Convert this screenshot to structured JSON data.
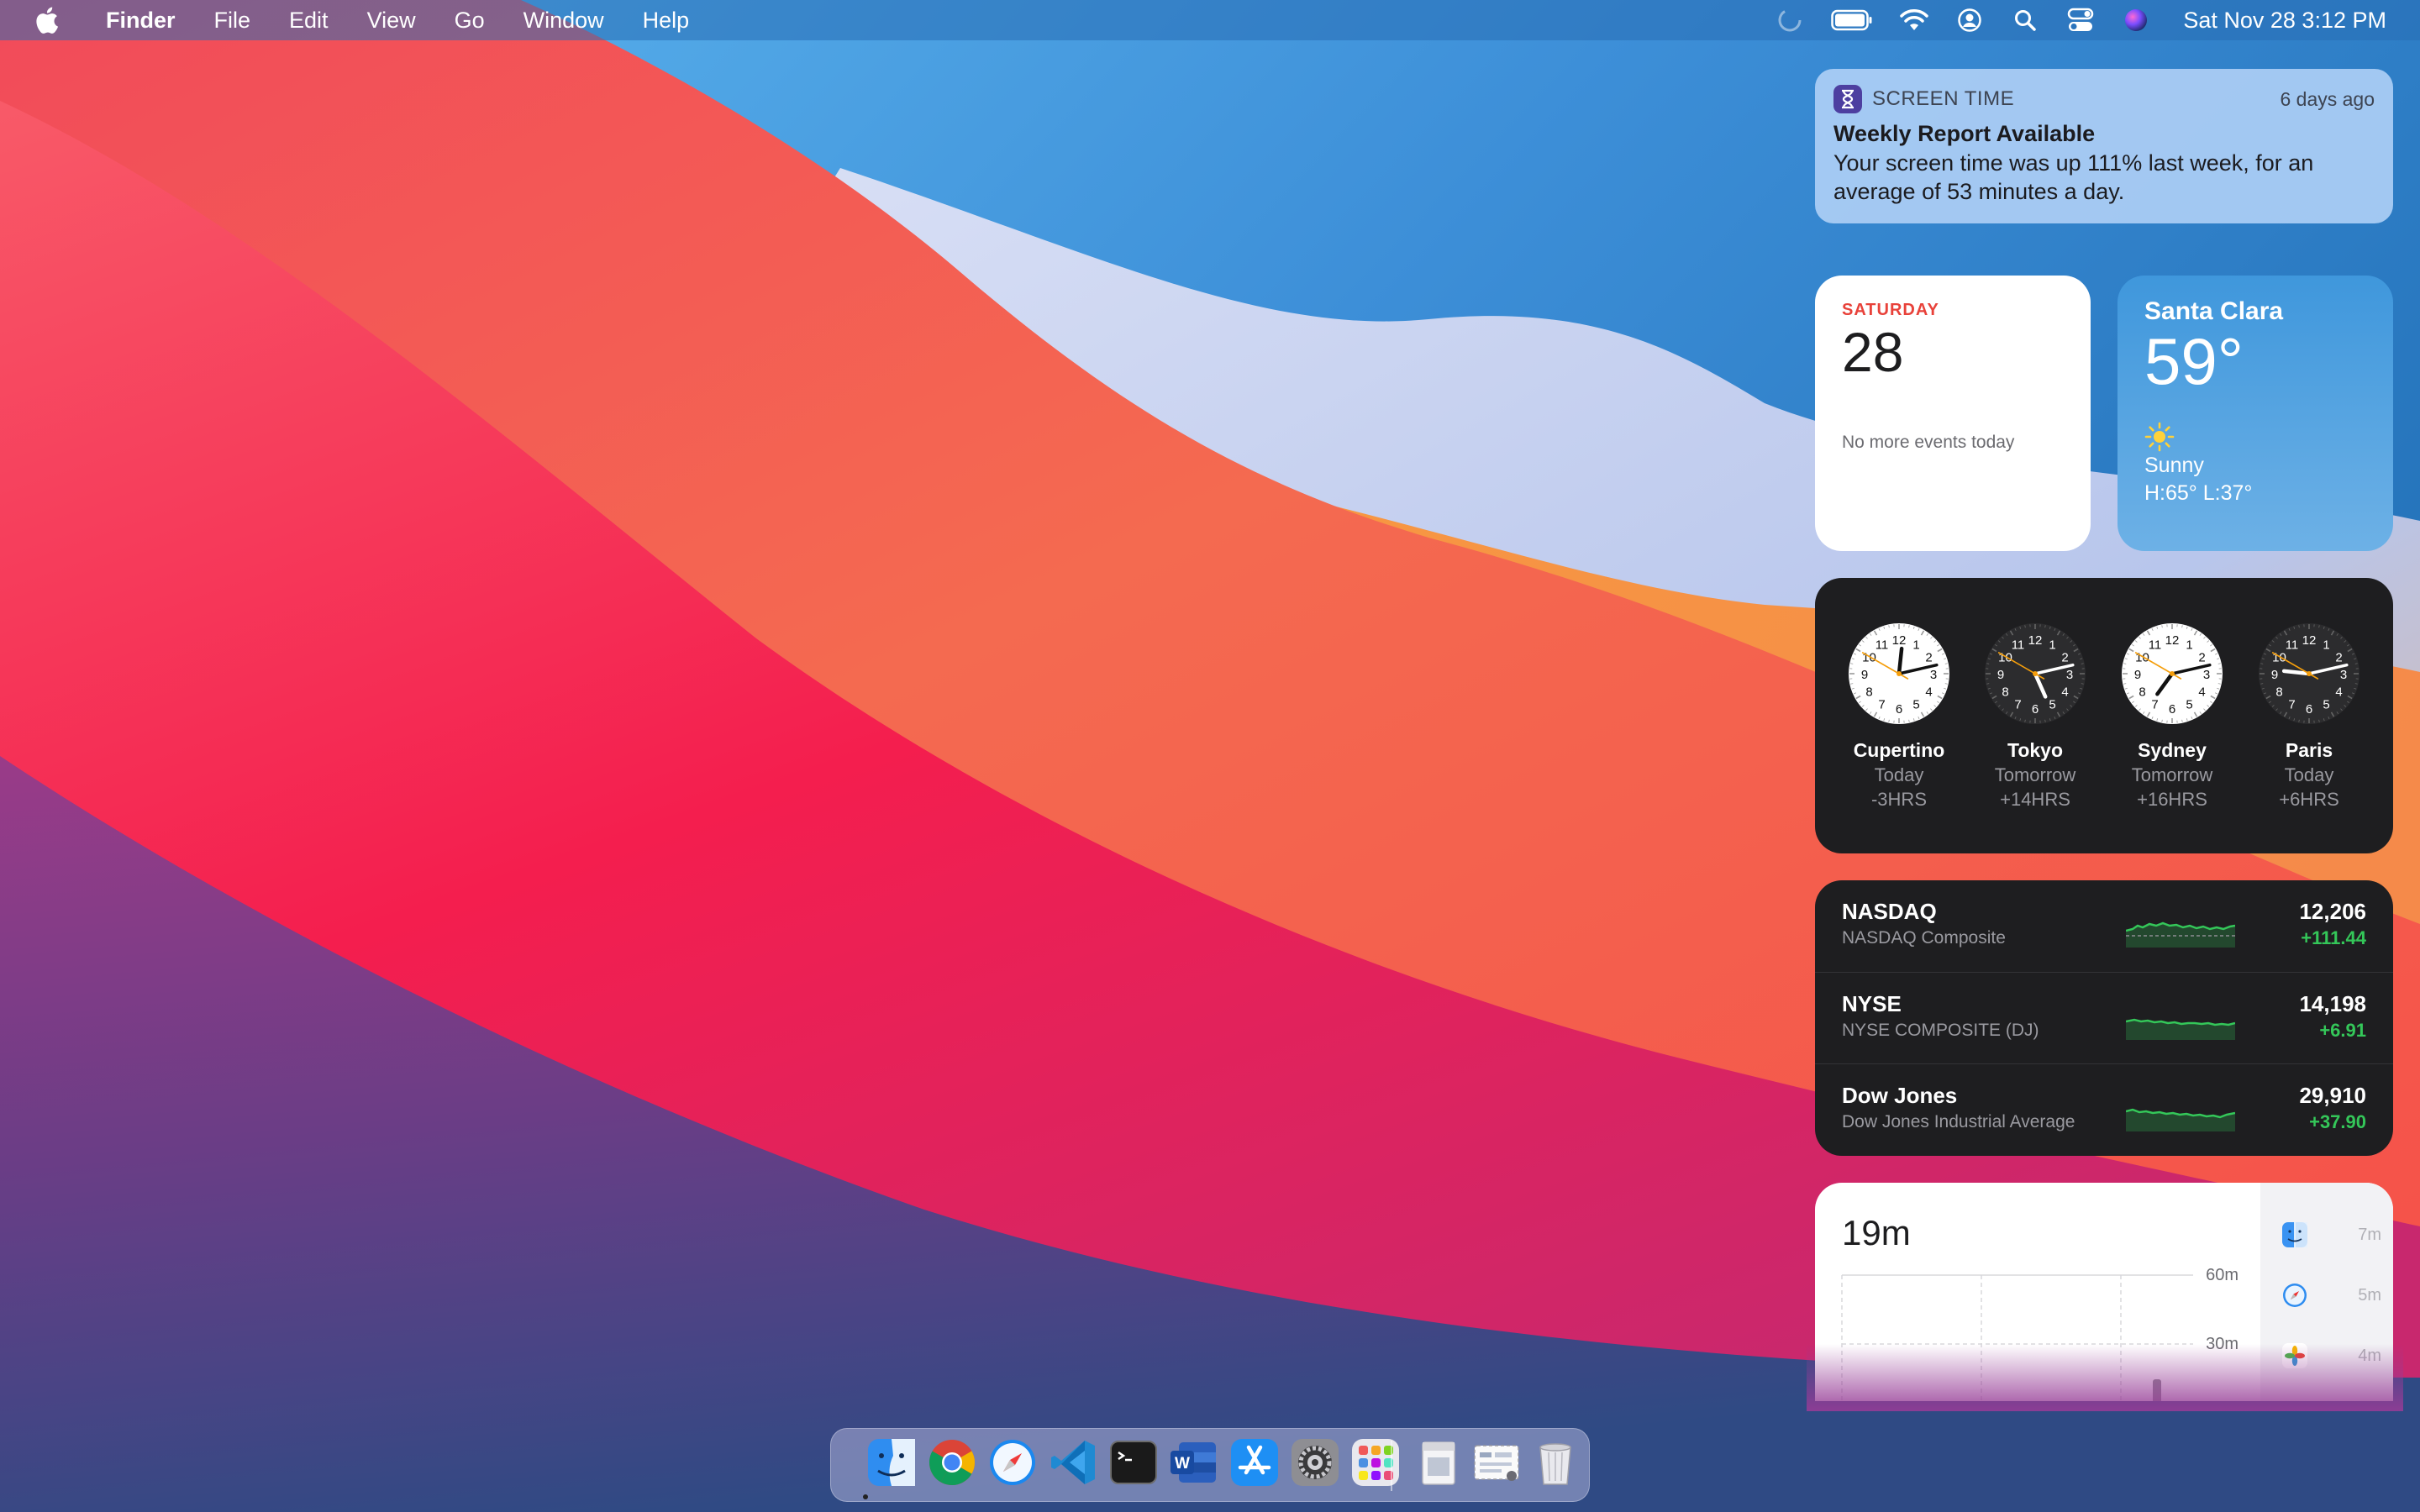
{
  "menubar": {
    "app_name": "Finder",
    "items": [
      "File",
      "Edit",
      "View",
      "Go",
      "Window",
      "Help"
    ],
    "datetime": "Sat Nov 28  3:12 PM",
    "status_icons": [
      "focus-moon-icon",
      "battery-icon",
      "wifi-icon",
      "user-icon",
      "search-icon",
      "control-center-icon",
      "siri-icon"
    ]
  },
  "notification": {
    "app": "SCREEN TIME",
    "time": "6 days ago",
    "title": "Weekly Report Available",
    "body": "Your screen time was up 111% last week, for an average of 53 minutes a day."
  },
  "calendar": {
    "day": "SATURDAY",
    "date": "28",
    "events": "No more events today"
  },
  "weather": {
    "city": "Santa Clara",
    "temp": "59°",
    "condition": "Sunny",
    "high_low": "H:65° L:37°"
  },
  "world_clock": [
    {
      "city": "Cupertino",
      "rel": "Today",
      "offset": "-3HRS",
      "time": "12:12:50",
      "theme": "light"
    },
    {
      "city": "Tokyo",
      "rel": "Tomorrow",
      "offset": "+14HRS",
      "time": "05:12:50",
      "theme": "dark"
    },
    {
      "city": "Sydney",
      "rel": "Tomorrow",
      "offset": "+16HRS",
      "time": "07:12:50",
      "theme": "light"
    },
    {
      "city": "Paris",
      "rel": "Today",
      "offset": "+6HRS",
      "time": "21:12:50",
      "theme": "dark"
    }
  ],
  "stocks": [
    {
      "symbol": "NASDAQ",
      "name": "NASDAQ Composite",
      "price": "12,206",
      "change": "+111.44"
    },
    {
      "symbol": "NYSE",
      "name": "NYSE COMPOSITE (DJ)",
      "price": "14,198",
      "change": "+6.91"
    },
    {
      "symbol": "Dow Jones",
      "name": "Dow Jones Industrial Average",
      "price": "29,910",
      "change": "+37.90"
    }
  ],
  "screen_time": {
    "total": "19m",
    "axis_labels": [
      "60m",
      "30m"
    ],
    "apps": [
      {
        "icon": "finder-icon",
        "minutes": "7m"
      },
      {
        "icon": "safari-icon",
        "minutes": "5m"
      },
      {
        "icon": "photos-icon",
        "minutes": "4m"
      }
    ]
  },
  "dock": {
    "apps": [
      "finder-icon",
      "chrome-icon",
      "safari-icon",
      "vscode-icon",
      "terminal-icon",
      "word-icon",
      "app-store-icon",
      "system-preferences-icon",
      "launchpad-icon",
      "preview-document-icon",
      "screenshot-icon",
      "trash-icon"
    ]
  },
  "colors": {
    "positive": "#34c759",
    "calendar_accent": "#e8423a",
    "widget_dark": "#1e1e20"
  }
}
